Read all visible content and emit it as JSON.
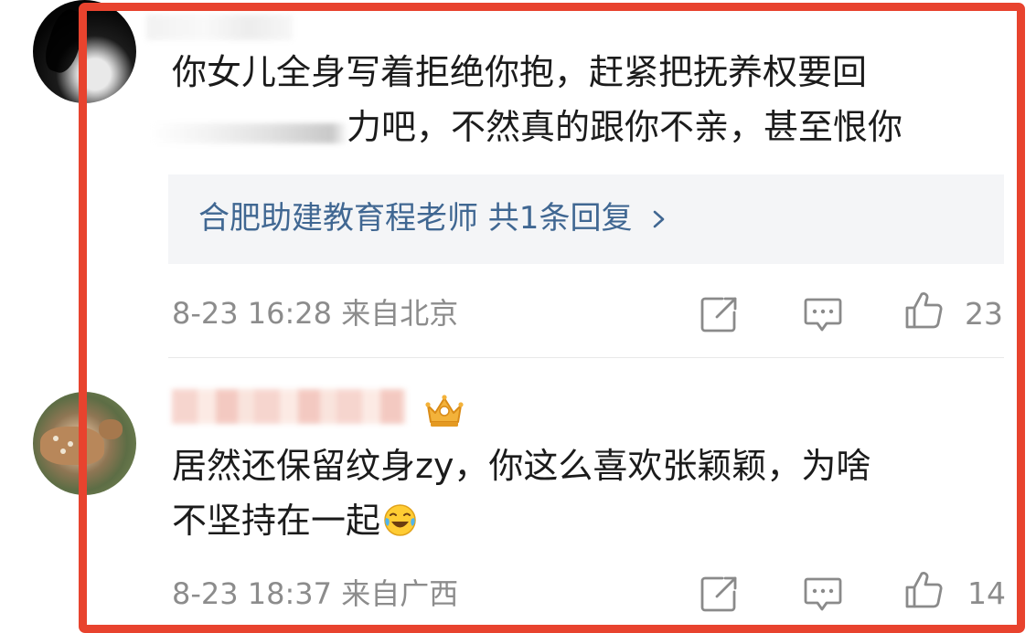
{
  "comments": [
    {
      "text_line1": "你女儿全身写着拒绝你抱，赶紧把抚养权要回",
      "text_line2": "力吧，不然真的跟你不亲，甚至恨你",
      "reply_summary": "合肥助建教育程老师 共1条回复",
      "timestamp": "8-23 16:28",
      "location": "来自北京",
      "likes": "23",
      "icons": [
        "share-icon",
        "comment-icon",
        "like-icon"
      ]
    },
    {
      "text_line1": "居然还保留纹身zy，你这么喜欢张颖颖，为啥",
      "text_line2": "不坚持在一起",
      "emoji": "laughing-crying-emoji",
      "timestamp": "8-23 18:37",
      "location": "来自广西",
      "likes": "14",
      "badge": "crown-icon",
      "icons": [
        "share-icon",
        "comment-icon",
        "like-icon"
      ]
    }
  ],
  "colors": {
    "highlight_frame": "#e8432e",
    "reply_link": "#406792",
    "meta_text": "#8c8c8c"
  }
}
